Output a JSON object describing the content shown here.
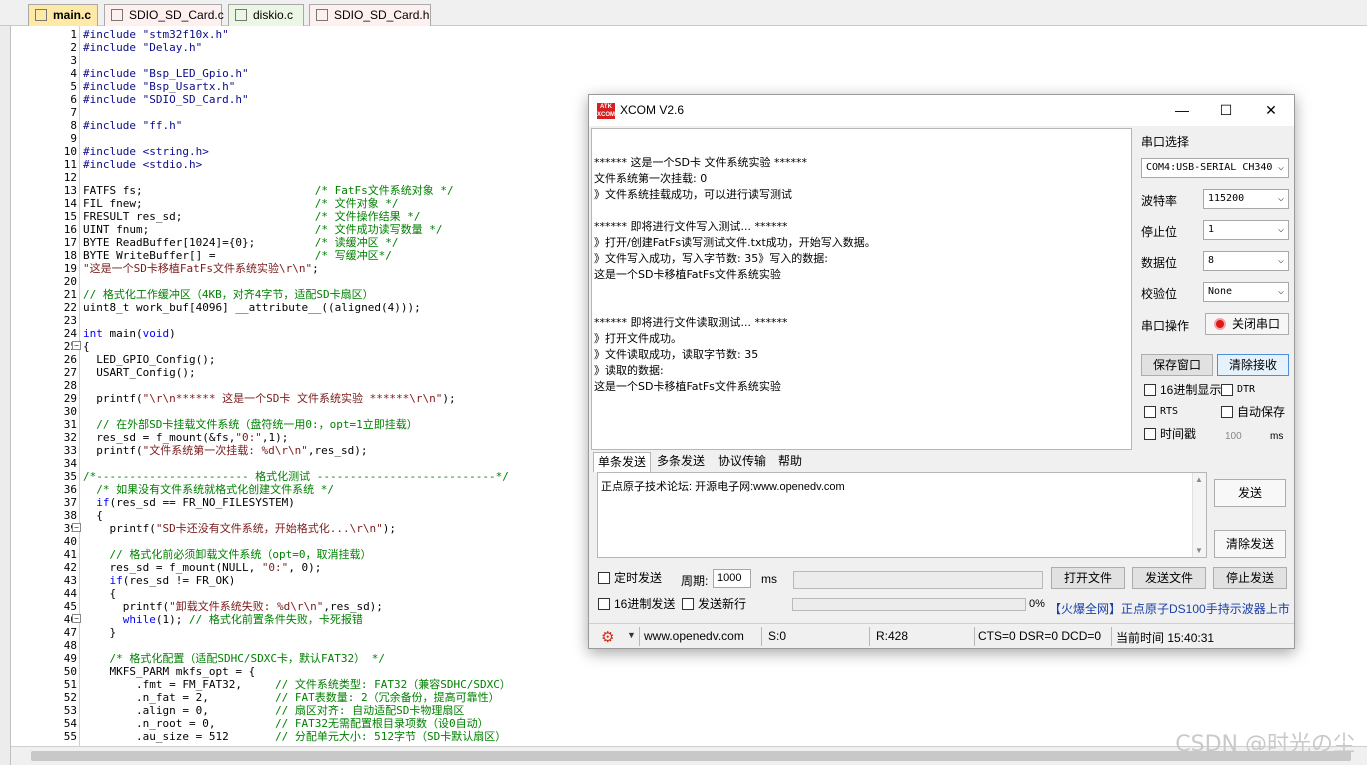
{
  "editor": {
    "tabs": [
      {
        "label": "main.c",
        "color": "#ffe9a6"
      },
      {
        "label": "SDIO_SD_Card.c",
        "color": "#fff0f0"
      },
      {
        "label": "diskio.c",
        "color": "#ecf6e4"
      },
      {
        "label": "SDIO_SD_Card.h",
        "color": "#fff0f0"
      }
    ],
    "code_lines": [
      {
        "n": "1",
        "text": "#include \"stm32f10x.h\""
      },
      {
        "n": "2",
        "text": "#include \"Delay.h\""
      },
      {
        "n": "3",
        "text": ""
      },
      {
        "n": "4",
        "text": "#include \"Bsp_LED_Gpio.h\""
      },
      {
        "n": "5",
        "text": "#include \"Bsp_Usartx.h\""
      },
      {
        "n": "6",
        "text": "#include \"SDIO_SD_Card.h\""
      },
      {
        "n": "7",
        "text": ""
      },
      {
        "n": "8",
        "text": "#include \"ff.h\""
      },
      {
        "n": "9",
        "text": ""
      },
      {
        "n": "10",
        "text": "#include <string.h>"
      },
      {
        "n": "11",
        "text": "#include <stdio.h>"
      },
      {
        "n": "12",
        "text": ""
      },
      {
        "n": "13",
        "text": "FATFS fs;                          /* FatFs文件系统对象 */"
      },
      {
        "n": "14",
        "text": "FIL fnew;                          /* 文件对象 */"
      },
      {
        "n": "15",
        "text": "FRESULT res_sd;                    /* 文件操作结果 */"
      },
      {
        "n": "16",
        "text": "UINT fnum;                         /* 文件成功读写数量 */"
      },
      {
        "n": "17",
        "text": "BYTE ReadBuffer[1024]={0};         /* 读缓冲区 */"
      },
      {
        "n": "18",
        "text": "BYTE WriteBuffer[] =               /* 写缓冲区*/"
      },
      {
        "n": "19",
        "text": "\"这是一个SD卡移植FatFs文件系统实验\\r\\n\";"
      },
      {
        "n": "20",
        "text": ""
      },
      {
        "n": "21",
        "text": "// 格式化工作缓冲区（4KB，对齐4字节，适配SD卡扇区）"
      },
      {
        "n": "22",
        "text": "uint8_t work_buf[4096] __attribute__((aligned(4)));"
      },
      {
        "n": "23",
        "text": ""
      },
      {
        "n": "24",
        "text": "int main(void)"
      },
      {
        "n": "25",
        "text": "{"
      },
      {
        "n": "26",
        "text": "  LED_GPIO_Config();"
      },
      {
        "n": "27",
        "text": "  USART_Config();"
      },
      {
        "n": "28",
        "text": ""
      },
      {
        "n": "29",
        "text": "  printf(\"\\r\\n****** 这是一个SD卡 文件系统实验 ******\\r\\n\");"
      },
      {
        "n": "30",
        "text": ""
      },
      {
        "n": "31",
        "text": "  // 在外部SD卡挂载文件系统（盘符统一用0:，opt=1立即挂载）"
      },
      {
        "n": "32",
        "text": "  res_sd = f_mount(&fs,\"0:\",1);"
      },
      {
        "n": "33",
        "text": "  printf(\"文件系统第一次挂载: %d\\r\\n\",res_sd);"
      },
      {
        "n": "34",
        "text": ""
      },
      {
        "n": "35",
        "text": "/*----------------------- 格式化测试 ---------------------------*/"
      },
      {
        "n": "36",
        "text": "  /* 如果没有文件系统就格式化创建文件系统 */"
      },
      {
        "n": "37",
        "text": "  if(res_sd == FR_NO_FILESYSTEM)"
      },
      {
        "n": "38",
        "text": "  {"
      },
      {
        "n": "39",
        "text": "    printf(\"SD卡还没有文件系统，开始格式化...\\r\\n\");"
      },
      {
        "n": "40",
        "text": ""
      },
      {
        "n": "41",
        "text": "    // 格式化前必须卸载文件系统（opt=0，取消挂载）"
      },
      {
        "n": "42",
        "text": "    res_sd = f_mount(NULL, \"0:\", 0);"
      },
      {
        "n": "43",
        "text": "    if(res_sd != FR_OK)"
      },
      {
        "n": "44",
        "text": "    {"
      },
      {
        "n": "45",
        "text": "      printf(\"卸载文件系统失败: %d\\r\\n\",res_sd);"
      },
      {
        "n": "46",
        "text": "      while(1); // 格式化前置条件失败，卡死报错"
      },
      {
        "n": "47",
        "text": "    }"
      },
      {
        "n": "48",
        "text": ""
      },
      {
        "n": "49",
        "text": "    /* 格式化配置（适配SDHC/SDXC卡，默认FAT32） */"
      },
      {
        "n": "50",
        "text": "    MKFS_PARM mkfs_opt = {"
      },
      {
        "n": "51",
        "text": "        .fmt = FM_FAT32,     // 文件系统类型: FAT32（兼容SDHC/SDXC）"
      },
      {
        "n": "52",
        "text": "        .n_fat = 2,          // FAT表数量: 2（冗余备份，提高可靠性）"
      },
      {
        "n": "53",
        "text": "        .align = 0,          // 扇区对齐: 自动适配SD卡物理扇区"
      },
      {
        "n": "54",
        "text": "        .n_root = 0,         // FAT32无需配置根目录项数（设0自动）"
      },
      {
        "n": "55",
        "text": "        .au_size = 512       // 分配单元大小: 512字节（SD卡默认扇区）"
      }
    ],
    "watermark": "CSDN @时光の尘"
  },
  "xcom": {
    "title": "XCOM V2.6",
    "logo_text": "ATK XCOM",
    "receive_lines": [
      "",
      "****** 这是一个SD卡 文件系统实验 ******",
      "文件系统第一次挂载: 0",
      "》文件系统挂载成功，可以进行读写测试",
      "",
      "****** 即将进行文件写入测试... ******",
      "》打开/创建FatFs读写测试文件.txt成功，开始写入数据。",
      "》文件写入成功，写入字节数: 35》写入的数据:",
      "这是一个SD卡移植FatFs文件系统实验",
      "",
      "",
      "****** 即将进行文件读取测试... ******",
      "》打开文件成功。",
      "》文件读取成功，读取字节数: 35",
      "》读取的数据:",
      "这是一个SD卡移植FatFs文件系统实验"
    ],
    "panel": {
      "port_select_label": "串口选择",
      "port_value": "COM4:USB-SERIAL CH340",
      "baud_label": "波特率",
      "baud_value": "115200",
      "stop_label": "停止位",
      "stop_value": "1",
      "data_label": "数据位",
      "data_value": "8",
      "parity_label": "校验位",
      "parity_value": "None",
      "port_op_label": "串口操作",
      "close_port_button": "关闭串口",
      "save_window_button": "保存窗口",
      "clear_recv_button": "清除接收",
      "hex_display": "16进制显示",
      "dtr": "DTR",
      "rts": "RTS",
      "auto_save": "自动保存",
      "timestamp": "时间戳",
      "timestamp_ms_value": "100",
      "timestamp_ms_unit": "ms"
    },
    "send_tabs": [
      "单条发送",
      "多条发送",
      "协议传输",
      "帮助"
    ],
    "send_text": "正点原子技术论坛: 开源电子网:www.openedv.com",
    "send_button": "发送",
    "clear_send_button": "清除发送",
    "timed_send": "定时发送",
    "period_label": "周期:",
    "period_value": "1000",
    "period_unit": "ms",
    "open_file_button": "打开文件",
    "send_file_button": "发送文件",
    "stop_send_button": "停止发送",
    "hex_send": "16进制发送",
    "send_newline": "发送新行",
    "progress_percent": "0%",
    "progress_fraction": 0,
    "ad_link": "【火爆全网】正点原子DS100手持示波器上市",
    "status": {
      "url": "www.openedv.com",
      "sent": "S:0",
      "received": "R:428",
      "lines": "CTS=0 DSR=0 DCD=0",
      "time": "当前时间 15:40:31"
    }
  }
}
